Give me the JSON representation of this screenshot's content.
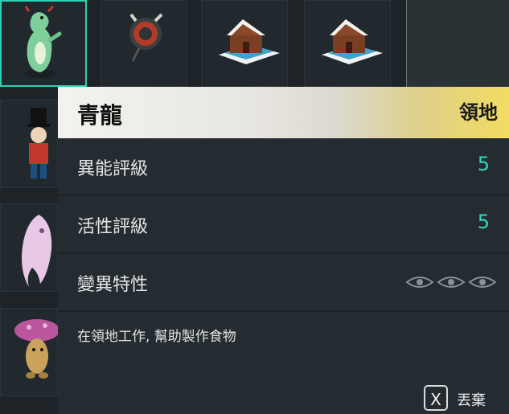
{
  "grid": {
    "items": [
      "dragon-figurine-icon",
      "round-drone-icon",
      "gingerbread-house-icon",
      "gingerbread-house-icon",
      "nutcracker-figurine-icon",
      "pink-ghost-icon",
      "mushroom-creature-icon"
    ]
  },
  "detail": {
    "name": "青龍",
    "category": "領地",
    "stats": [
      {
        "label": "異能評級",
        "value": "5"
      },
      {
        "label": "活性評級",
        "value": "5"
      },
      {
        "label": "變異特性",
        "value": ""
      }
    ],
    "description": "在領地工作, 幫助製作食物"
  },
  "footer": {
    "key": "X",
    "action_label": "丟棄"
  },
  "colors": {
    "accent": "#34d6bf",
    "header_gold": "#f3dc62",
    "selection": "#2fd0b5"
  }
}
